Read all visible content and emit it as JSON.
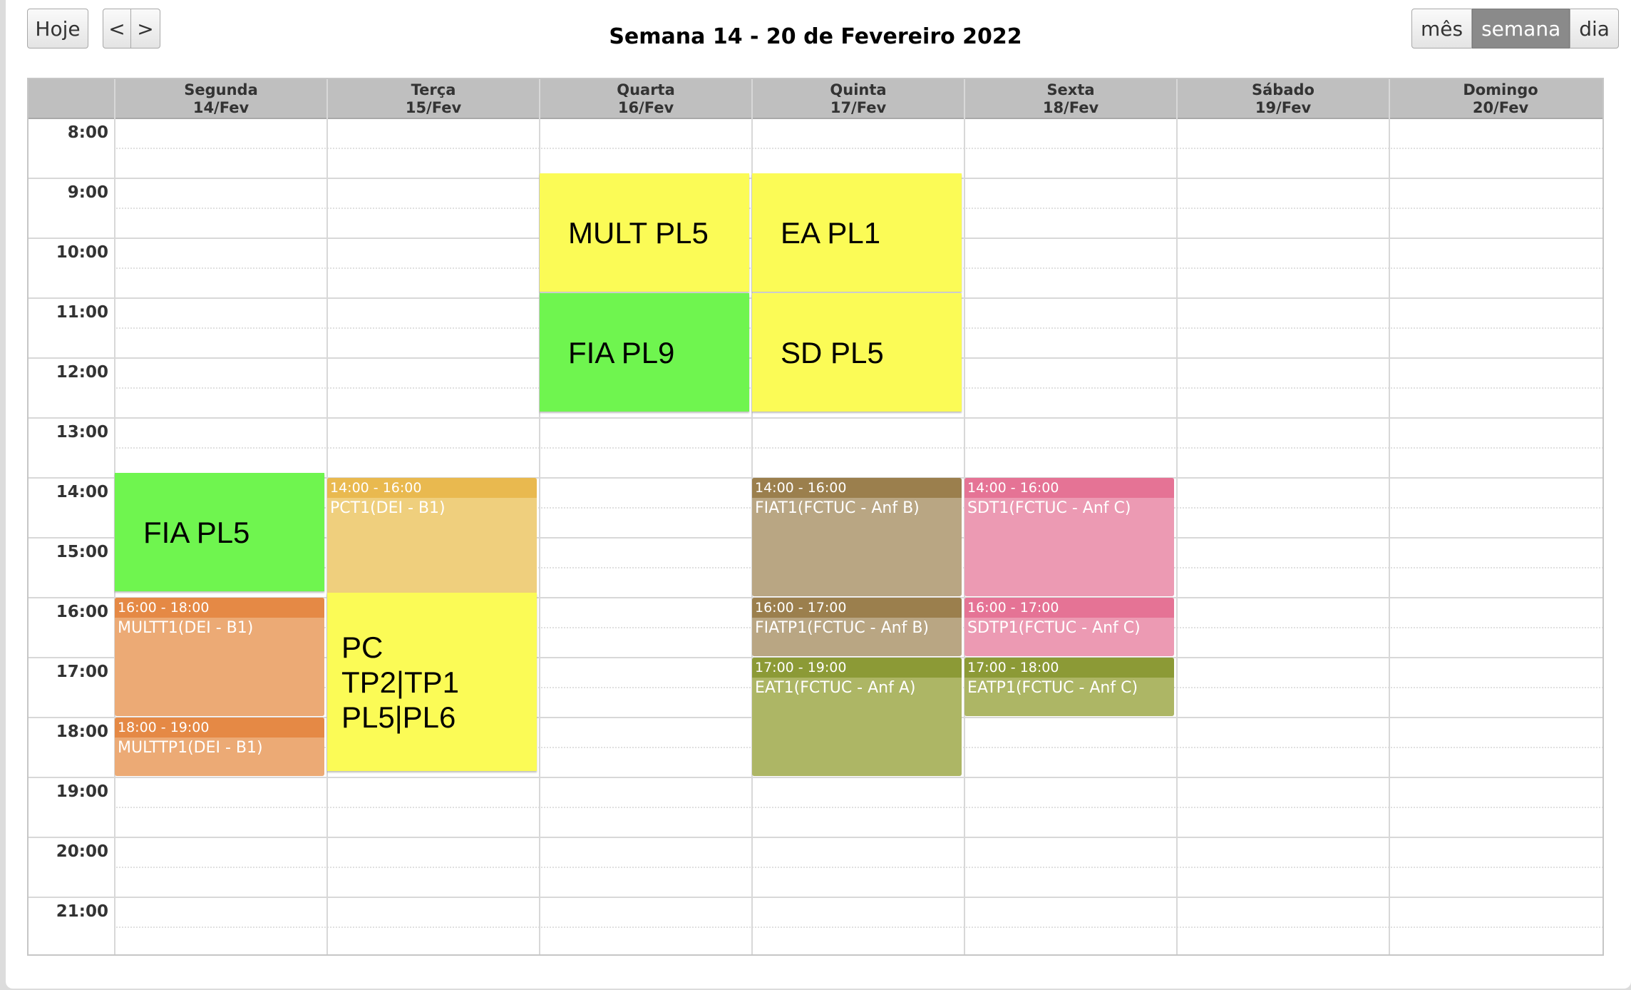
{
  "toolbar": {
    "today_label": "Hoje",
    "prev_label": "<",
    "next_label": ">",
    "title": "Semana 14 - 20 de Fevereiro 2022",
    "views": [
      "mês",
      "semana",
      "dia"
    ],
    "active_view": "semana"
  },
  "days": [
    {
      "name": "Segunda",
      "date": "14/Fev"
    },
    {
      "name": "Terça",
      "date": "15/Fev"
    },
    {
      "name": "Quarta",
      "date": "16/Fev"
    },
    {
      "name": "Quinta",
      "date": "17/Fev"
    },
    {
      "name": "Sexta",
      "date": "18/Fev"
    },
    {
      "name": "Sábado",
      "date": "19/Fev"
    },
    {
      "name": "Domingo",
      "date": "20/Fev"
    }
  ],
  "hours": [
    "8:00",
    "9:00",
    "10:00",
    "11:00",
    "12:00",
    "13:00",
    "14:00",
    "15:00",
    "16:00",
    "17:00",
    "18:00",
    "19:00",
    "20:00",
    "21:00"
  ],
  "events": [
    {
      "day": 1,
      "start": 14,
      "end": 16,
      "time": "14:00 - 16:00",
      "title": "PCT1(DEI - B1)",
      "header_color": "#e9b94f",
      "body_color": "#efcf7d"
    },
    {
      "day": 0,
      "start": 16,
      "end": 18,
      "time": "16:00 - 18:00",
      "title": "MULTT1(DEI - B1)",
      "header_color": "#e58945",
      "body_color": "#ecaa75"
    },
    {
      "day": 0,
      "start": 18,
      "end": 19,
      "time": "18:00 - 19:00",
      "title": "MULTTP1(DEI - B1)",
      "header_color": "#e58945",
      "body_color": "#ecaa75"
    },
    {
      "day": 3,
      "start": 14,
      "end": 16,
      "time": "14:00 - 16:00",
      "title": "FIAT1(FCTUC - Anf B)",
      "header_color": "#9b7f4d",
      "body_color": "#b9a683"
    },
    {
      "day": 3,
      "start": 16,
      "end": 17,
      "time": "16:00 - 17:00",
      "title": "FIATP1(FCTUC - Anf B)",
      "header_color": "#9b7f4d",
      "body_color": "#b9a683"
    },
    {
      "day": 3,
      "start": 17,
      "end": 19,
      "time": "17:00 - 19:00",
      "title": "EAT1(FCTUC - Anf A)",
      "header_color": "#8c9a36",
      "body_color": "#adb665"
    },
    {
      "day": 4,
      "start": 14,
      "end": 16,
      "time": "14:00 - 16:00",
      "title": "SDT1(FCTUC - Anf C)",
      "header_color": "#e57395",
      "body_color": "#ec9ab3"
    },
    {
      "day": 4,
      "start": 16,
      "end": 17,
      "time": "16:00 - 17:00",
      "title": "SDTP1(FCTUC - Anf C)",
      "header_color": "#e57395",
      "body_color": "#ec9ab3"
    },
    {
      "day": 4,
      "start": 17,
      "end": 18,
      "time": "17:00 - 18:00",
      "title": "EATP1(FCTUC - Anf C)",
      "header_color": "#8c9a36",
      "body_color": "#adb665"
    }
  ],
  "sticky_notes": [
    {
      "day": 2,
      "start": 9,
      "end": 11,
      "lines": [
        "MULT PL5"
      ],
      "color": "#fbfb56"
    },
    {
      "day": 3,
      "start": 9,
      "end": 11,
      "lines": [
        "EA PL1"
      ],
      "color": "#fbfb56"
    },
    {
      "day": 2,
      "start": 11,
      "end": 13,
      "lines": [
        "FIA PL9"
      ],
      "color": "#6ff54f"
    },
    {
      "day": 3,
      "start": 11,
      "end": 13,
      "lines": [
        "SD PL5"
      ],
      "color": "#fbfb56"
    },
    {
      "day": 0,
      "start": 14,
      "end": 16,
      "lines": [
        "FIA PL5"
      ],
      "color": "#6ff54f"
    },
    {
      "day": 1,
      "start": 16,
      "end": 19,
      "lines": [
        "PC",
        "TP2|TP1",
        "PL5|PL6"
      ],
      "color": "#fbfb56"
    }
  ]
}
